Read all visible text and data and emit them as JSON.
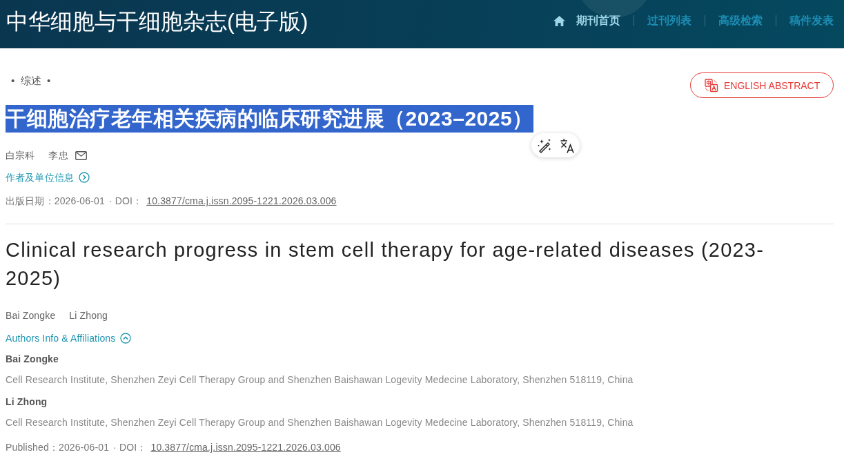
{
  "header": {
    "journal_title": "中华细胞与干细胞杂志(电子版)",
    "nav": [
      {
        "label": "期刊首页",
        "kind": "home",
        "selected": true
      },
      {
        "label": "过刊列表",
        "kind": "link",
        "selected": false
      },
      {
        "label": "高级检索",
        "kind": "link",
        "selected": false
      },
      {
        "label": "稿件发表",
        "kind": "link",
        "selected": false
      }
    ]
  },
  "article": {
    "category": "•  综述  •",
    "english_abstract_button": "ENGLISH ABSTRACT",
    "title_zh": {
      "text": "干细胞治疗老年相关疾病的临床研究进展（2023–2025）",
      "highlighted": true
    },
    "authors_zh": [
      {
        "name": "白宗科",
        "corresponding": false
      },
      {
        "name": "李忠",
        "corresponding": true
      }
    ],
    "author_info_link_zh": {
      "label": "作者及单位信息",
      "expanded": false
    },
    "publication_zh": {
      "date": "出版日期：2026-06-01",
      "doi_label": "· DOI：",
      "doi": "10.3877/cma.j.issn.2095-1221.2026.03.006"
    },
    "title_en": "Clinical research progress in stem cell therapy for age-related diseases (2023-2025)",
    "authors_en": [
      "Bai Zongke",
      "Li Zhong"
    ],
    "author_info_link_en": {
      "label": "Authors Info & Affiliations",
      "expanded": true
    },
    "affiliations": [
      {
        "name": "Bai Zongke",
        "institution": "Cell Research Institute, Shenzhen Zeyi Cell Therapy Group and Shenzhen Baishawan Logevity Medecine Laboratory, Shenzhen 518119, China"
      },
      {
        "name": "Li Zhong",
        "institution": "Cell Research Institute, Shenzhen Zeyi Cell Therapy Group and Shenzhen Baishawan Logevity Medecine Laboratory, Shenzhen 518119, China"
      }
    ],
    "publication_en": {
      "date": "Published：2026-06-01",
      "doi_label": "· DOI：",
      "doi": "10.3877/cma.j.issn.2095-1221.2026.03.006"
    }
  }
}
